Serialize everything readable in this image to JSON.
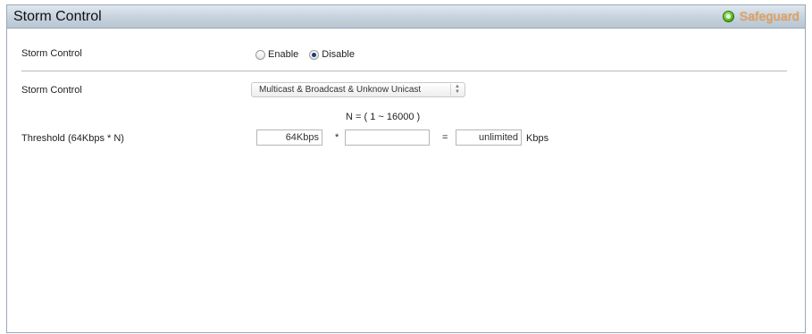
{
  "header": {
    "title": "Storm Control",
    "safeguard_label": "Safeguard",
    "safeguard_icon": "status-indicator-icon",
    "safeguard_color": "#e8a35a",
    "title_bar_color": "#c6d2de"
  },
  "storm_control_row": {
    "label": "Storm Control",
    "options": [
      {
        "label": "Enable",
        "selected": false
      },
      {
        "label": "Disable",
        "selected": true
      }
    ]
  },
  "type_row": {
    "label": "Storm Control",
    "selected_value": "Multicast & Broadcast & Unknow Unicast"
  },
  "threshold_row": {
    "label": "Threshold (64Kbps * N)",
    "n_range": "N = ( 1 ~ 16000 )",
    "base_value": "64Kbps",
    "multiply_symbol": "*",
    "n_value": "",
    "equals_symbol": "=",
    "result_value": "unlimited",
    "unit": "Kbps"
  }
}
